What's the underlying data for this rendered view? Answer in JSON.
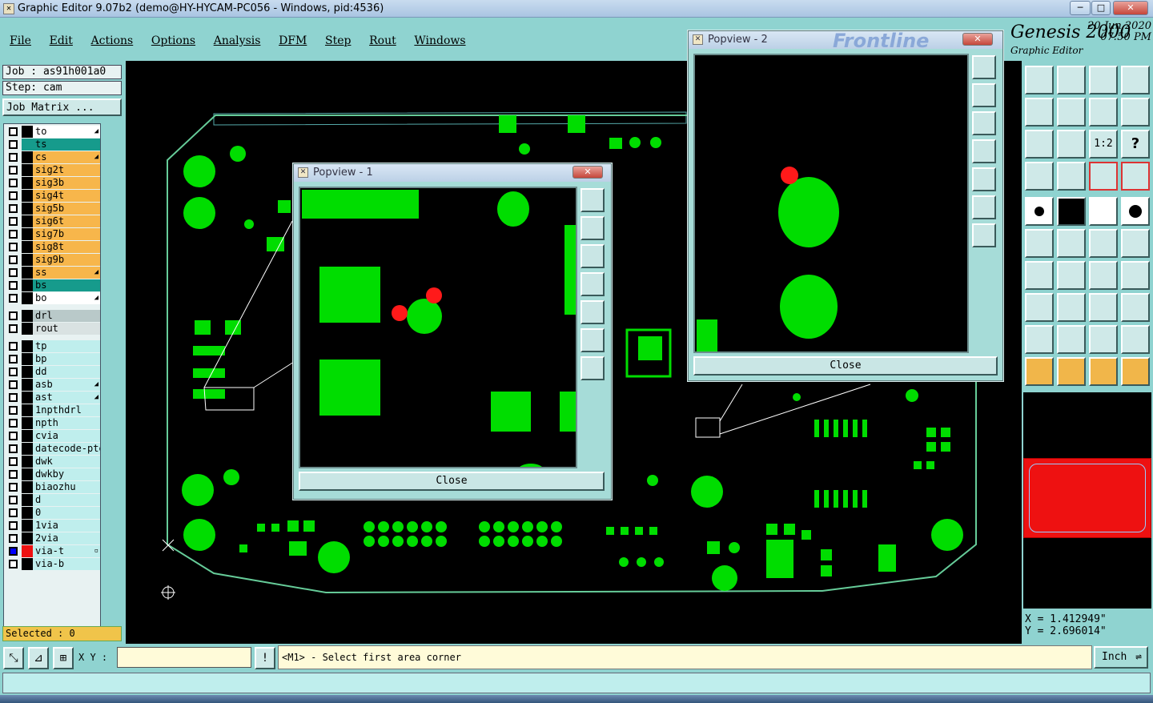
{
  "window": {
    "title": "Graphic Editor 9.07b2 (demo@HY-HYCAM-PC056 - Windows, pid:4536)",
    "minimize": "─",
    "maximize": "□",
    "close": "✕"
  },
  "menu": [
    "File",
    "Edit",
    "Actions",
    "Options",
    "Analysis",
    "DFM",
    "Step",
    "Rout",
    "Windows"
  ],
  "brand": {
    "title": "Genesis 2000",
    "date": "20  Jun  2020",
    "time": "07:50  PM",
    "subtitle": "Graphic Editor",
    "logo": "Frontline"
  },
  "job": {
    "job_label": "Job : as91h001a0",
    "step_label": "Step: cam",
    "matrix_button": "Job Matrix ..."
  },
  "layers": [
    {
      "name": "to",
      "color": "#ffffff",
      "mark": "◢"
    },
    {
      "name": "ts",
      "color": "#169b8c",
      "mark": "",
      "active": true
    },
    {
      "name": "cs",
      "color": "#f7b64b",
      "mark": "◢"
    },
    {
      "name": "sig2t",
      "color": "#f7b64b",
      "mark": ""
    },
    {
      "name": "sig3b",
      "color": "#f7b64b",
      "mark": ""
    },
    {
      "name": "sig4t",
      "color": "#f7b64b",
      "mark": ""
    },
    {
      "name": "sig5b",
      "color": "#f7b64b",
      "mark": ""
    },
    {
      "name": "sig6t",
      "color": "#f7b64b",
      "mark": ""
    },
    {
      "name": "sig7b",
      "color": "#f7b64b",
      "mark": ""
    },
    {
      "name": "sig8t",
      "color": "#f7b64b",
      "mark": ""
    },
    {
      "name": "sig9b",
      "color": "#f7b64b",
      "mark": ""
    },
    {
      "name": "ss",
      "color": "#f7b64b",
      "mark": "◢"
    },
    {
      "name": "bs",
      "color": "#169b8c",
      "mark": ""
    },
    {
      "name": "bo",
      "color": "#ffffff",
      "mark": "◢"
    },
    {
      "name": "drl",
      "color": "#b9c9c9",
      "mark": ""
    },
    {
      "name": "rout",
      "color": "#d9e2e2",
      "mark": ""
    },
    {
      "name": "tp",
      "color": "#bfeeed",
      "mark": ""
    },
    {
      "name": "bp",
      "color": "#bfeeed",
      "mark": ""
    },
    {
      "name": "dd",
      "color": "#bfeeed",
      "mark": ""
    },
    {
      "name": "asb",
      "color": "#bfeeed",
      "mark": "◢"
    },
    {
      "name": "ast",
      "color": "#bfeeed",
      "mark": "◢"
    },
    {
      "name": "1npthdrl",
      "color": "#bfeeed",
      "mark": ""
    },
    {
      "name": "npth",
      "color": "#bfeeed",
      "mark": ""
    },
    {
      "name": "cvia",
      "color": "#bfeeed",
      "mark": ""
    },
    {
      "name": "datecode-pte",
      "color": "#bfeeed",
      "mark": ""
    },
    {
      "name": "dwk",
      "color": "#bfeeed",
      "mark": ""
    },
    {
      "name": "dwkby",
      "color": "#bfeeed",
      "mark": ""
    },
    {
      "name": "biaozhu",
      "color": "#bfeeed",
      "mark": ""
    },
    {
      "name": "d",
      "color": "#bfeeed",
      "mark": ""
    },
    {
      "name": "0",
      "color": "#bfeeed",
      "mark": ""
    },
    {
      "name": "1via",
      "color": "#bfeeed",
      "mark": ""
    },
    {
      "name": "2via",
      "color": "#bfeeed",
      "mark": ""
    },
    {
      "name": "via-t",
      "color": "#bfeeed",
      "mark": "▫",
      "swatch": "#e11"
    },
    {
      "name": "via-b",
      "color": "#bfeeed",
      "mark": ""
    }
  ],
  "selected": "Selected : 0",
  "popview1": {
    "title": "Popview - 1",
    "close": "Close"
  },
  "popview2": {
    "title": "Popview - 2",
    "close": "Close"
  },
  "coords": {
    "x": "X = 1.412949\"",
    "y": "Y = 2.696014\""
  },
  "bottom": {
    "xy_label": "X Y :",
    "xy_value": "",
    "prompt": "<M1> - Select first area corner",
    "unit": "Inch"
  },
  "colors": {
    "copper": "#00dd00",
    "highlight": "#ff1a1a",
    "panel": "#8fd3d0"
  },
  "tools": {
    "row1": [
      "zoom-home-icon",
      "zoom-out-icon",
      "home-icon",
      "window-icon"
    ],
    "row2": [
      "pan-left-icon",
      "pan-right-icon",
      "mirror-icon",
      "swap-icon"
    ],
    "row3": [
      "fit-icon",
      "center-icon",
      "scale-1-2-icon",
      "help-icon"
    ],
    "row4": [
      "snap-icon",
      "grid-icon",
      "net-icon",
      "net-red-icon"
    ],
    "scale_label": "1:2",
    "help_label": "?"
  }
}
